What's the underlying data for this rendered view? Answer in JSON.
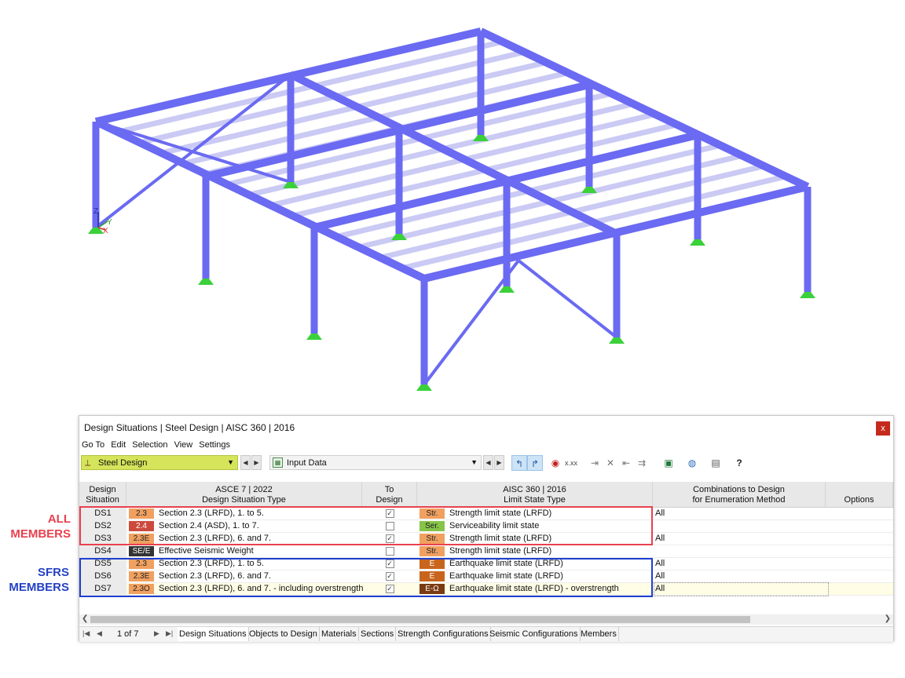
{
  "axes_labels": {
    "z": "Z",
    "y": "Y",
    "x": "X"
  },
  "callouts": {
    "all_members": [
      "ALL",
      "MEMBERS"
    ],
    "sfrs_members": [
      "SFRS",
      "MEMBERS"
    ]
  },
  "colors": {
    "frame_member": "#6a6af2",
    "support": "#3ad13a",
    "callout_red": "#e8414f",
    "callout_blue": "#2442c4",
    "combo_highlight": "#d5e45a"
  },
  "window": {
    "title": "Design Situations | Steel Design | AISC 360 | 2016",
    "close_label": "x",
    "menu": [
      "Go To",
      "Edit",
      "Selection",
      "View",
      "Settings"
    ],
    "module_combo": "Steel Design",
    "table_combo": "Input Data",
    "toolbar_icons": [
      "select-objects-icon",
      "deselect-icon",
      "view-icon",
      "numbering-icon",
      "export-icon",
      "delete-icon",
      "import-icon",
      "insert-icon",
      "excel-icon",
      "globe-icon",
      "report-icon",
      "help-icon"
    ]
  },
  "table": {
    "headers": {
      "col1": [
        "Design",
        "Situation"
      ],
      "col2": [
        "ASCE 7 | 2022",
        "Design Situation Type"
      ],
      "col3": [
        "To",
        "Design"
      ],
      "col4": [
        "AISC 360 | 2016",
        "Limit State Type"
      ],
      "col5": [
        "Combinations to Design",
        "for Enumeration Method"
      ],
      "col6": [
        "Options"
      ]
    },
    "rows": [
      {
        "name": "DS1",
        "code": "2.3",
        "code_color": "#f0a060",
        "type": "Section 2.3 (LRFD), 1. to 5.",
        "to_design": true,
        "ls_code": "Str.",
        "ls_color": "#f0a060",
        "ls_text": "Strength limit state (LRFD)",
        "combinations": "All"
      },
      {
        "name": "DS2",
        "code": "2.4",
        "code_color": "#cc4a3c",
        "type": "Section 2.4 (ASD), 1. to 7.",
        "to_design": false,
        "ls_code": "Ser.",
        "ls_color": "#86c44a",
        "ls_text": "Serviceability limit state",
        "combinations": ""
      },
      {
        "name": "DS3",
        "code": "2.3E",
        "code_color": "#f0a060",
        "type": "Section 2.3 (LRFD), 6. and 7.",
        "to_design": true,
        "ls_code": "Str.",
        "ls_color": "#f0a060",
        "ls_text": "Strength limit state (LRFD)",
        "combinations": "All"
      },
      {
        "name": "DS4",
        "code": "SE/E",
        "code_color": "#333333",
        "type": "Effective Seismic Weight",
        "to_design": false,
        "ls_code": "Str.",
        "ls_color": "#f0a060",
        "ls_text": "Strength limit state (LRFD)",
        "combinations": ""
      },
      {
        "name": "DS5",
        "code": "2.3",
        "code_color": "#f0a060",
        "type": "Section 2.3 (LRFD), 1. to 5.",
        "to_design": true,
        "ls_code": "E",
        "ls_color": "#c8651c",
        "ls_text": "Earthquake limit state (LRFD)",
        "combinations": "All"
      },
      {
        "name": "DS6",
        "code": "2.3E",
        "code_color": "#f0a060",
        "type": "Section 2.3 (LRFD), 6. and 7.",
        "to_design": true,
        "ls_code": "E",
        "ls_color": "#c8651c",
        "ls_text": "Earthquake limit state (LRFD)",
        "combinations": "All"
      },
      {
        "name": "DS7",
        "code": "2.3O",
        "code_color": "#f0a060",
        "type": "Section 2.3 (LRFD), 6. and 7. - including overstrength",
        "to_design": true,
        "ls_code": "E-Ω",
        "ls_color": "#7a3a12",
        "ls_text": "Earthquake limit state (LRFD) - overstrength",
        "combinations": "All"
      }
    ]
  },
  "footer": {
    "page_text": "1 of 7",
    "tabs": [
      "Design Situations",
      "Objects to Design",
      "Materials",
      "Sections",
      "Strength Configurations",
      "Seismic Configurations",
      "Members"
    ],
    "active_tab": "Design Situations"
  }
}
